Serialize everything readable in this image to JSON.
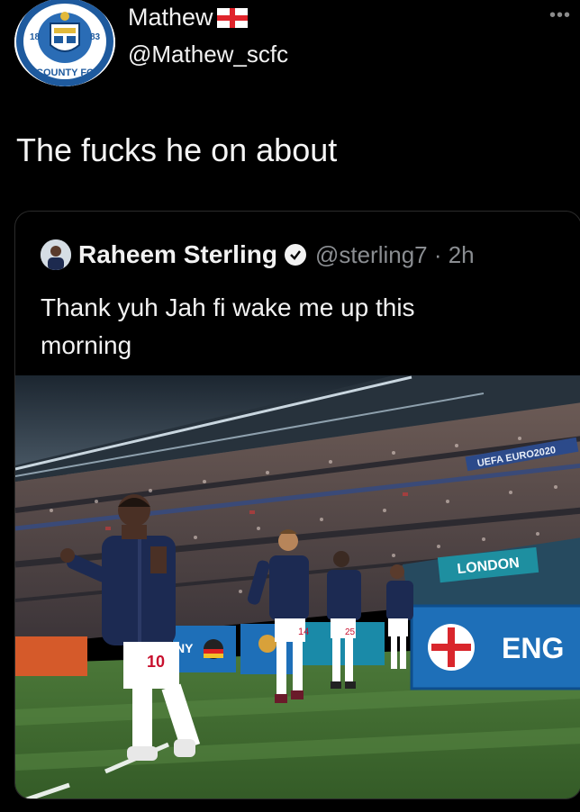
{
  "user": {
    "display_name": "Mathew",
    "handle": "@Mathew_scfc",
    "avatar_icon": "stockport-county-crest-icon",
    "avatar_ring_text": "COUNTY FC",
    "avatar_year_left": "18",
    "avatar_year_right": "83",
    "flag_icon": "england-flag-icon"
  },
  "tweet": {
    "text": "The fucks he on about",
    "more_icon": "more-icon"
  },
  "quoted_tweet": {
    "display_name": "Raheem Sterling",
    "handle_time": "@sterling7 · 2h",
    "verified_icon": "verified-badge-icon",
    "text": "Thank yuh Jah fi wake me up this morning",
    "photo": {
      "description_icon": "stadium-photo",
      "boards": {
        "london": "LONDON",
        "eng": "ENG",
        "uefa": "UEFA EURO2020",
        "partial": "NY",
        "kit_numbers": [
          "10",
          "14",
          "25"
        ]
      }
    }
  },
  "colors": {
    "background": "#000000",
    "text": "#f2f2f2",
    "secondary": "#8a8d91",
    "board_blue": "#1e6fb8",
    "pitch_green": "#3f6b2e"
  }
}
